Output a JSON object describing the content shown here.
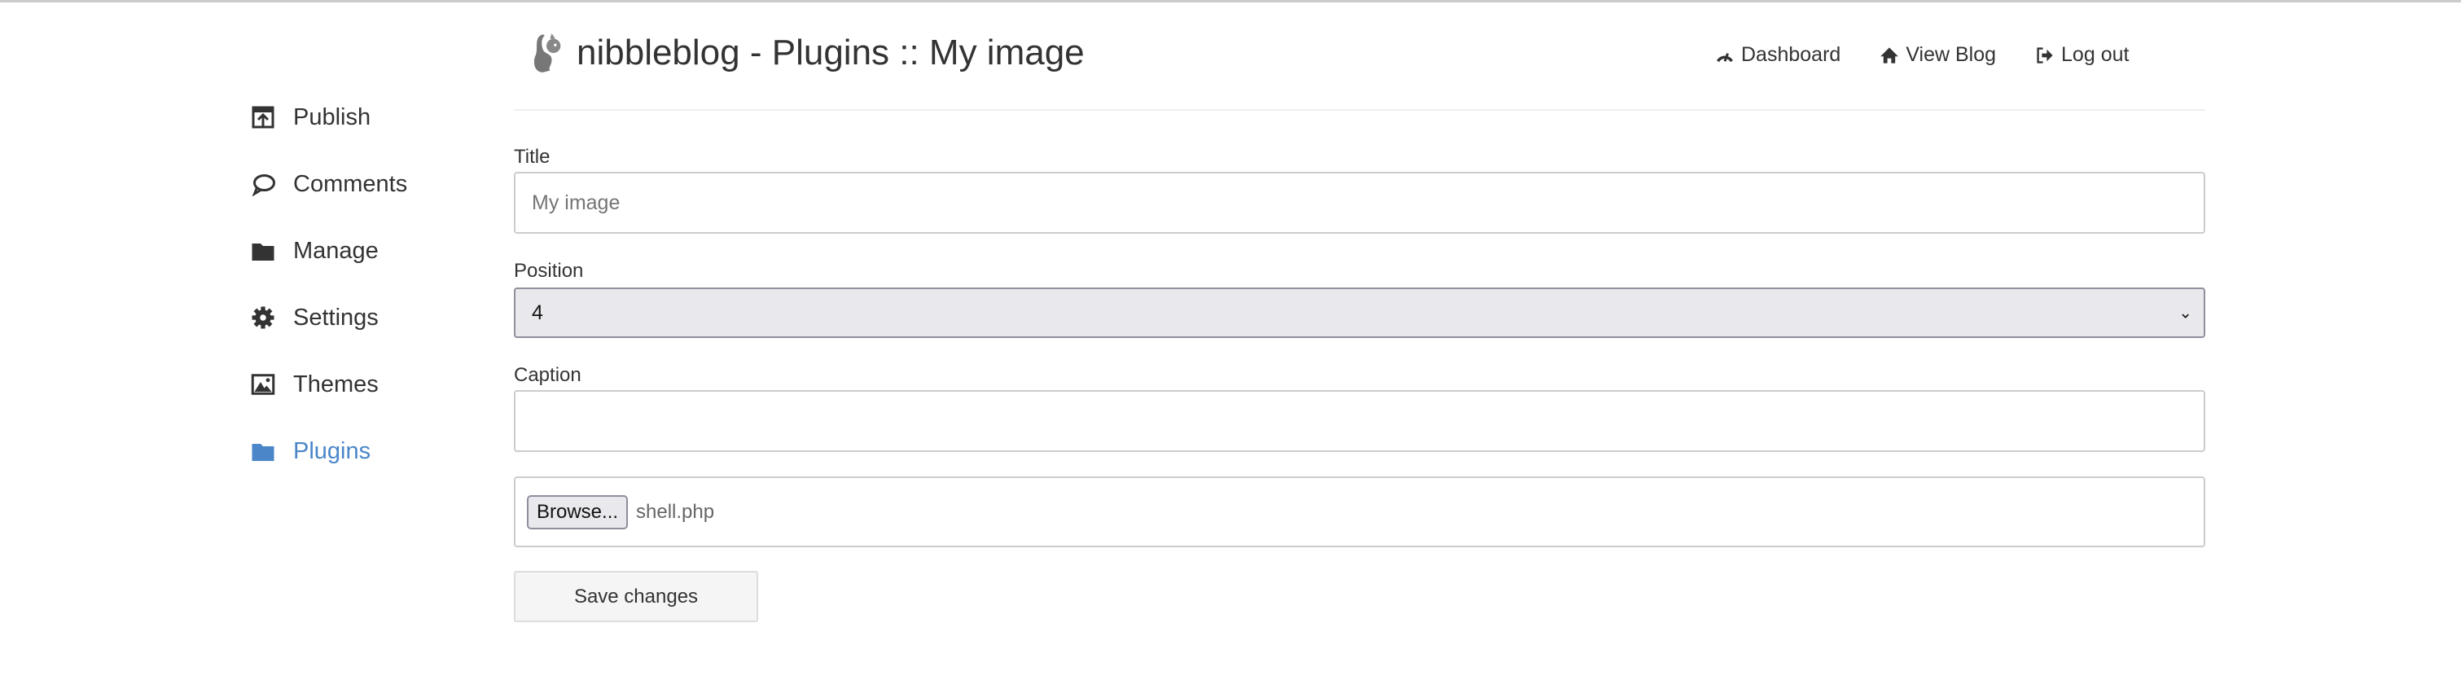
{
  "header": {
    "title": "nibbleblog - Plugins :: My image",
    "logo": "squirrel-logo"
  },
  "nav": [
    {
      "label": "Dashboard",
      "icon": "dashboard-icon"
    },
    {
      "label": "View Blog",
      "icon": "home-icon"
    },
    {
      "label": "Log out",
      "icon": "logout-icon"
    }
  ],
  "sidebar": {
    "active_color": "#4a86c8",
    "items": [
      {
        "label": "Publish",
        "icon": "publish-icon"
      },
      {
        "label": "Comments",
        "icon": "comment-icon"
      },
      {
        "label": "Manage",
        "icon": "folder-icon"
      },
      {
        "label": "Settings",
        "icon": "gear-icon"
      },
      {
        "label": "Themes",
        "icon": "image-icon"
      },
      {
        "label": "Plugins",
        "icon": "folder-icon",
        "active": true
      }
    ]
  },
  "form": {
    "title_label": "Title",
    "title_placeholder": "My image",
    "title_value": "",
    "position_label": "Position",
    "position_value": "4",
    "caption_label": "Caption",
    "caption_value": "",
    "browse_label": "Browse...",
    "file_name": "shell.php",
    "save_label": "Save changes"
  }
}
